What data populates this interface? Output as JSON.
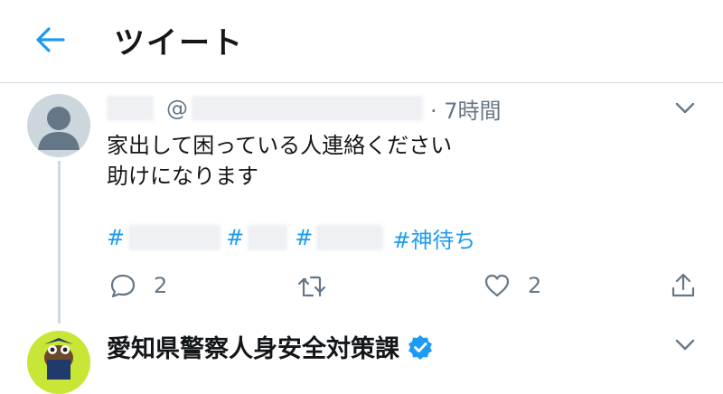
{
  "header": {
    "title": "ツイート",
    "back_icon": "arrow-left-icon"
  },
  "tweet": {
    "at_symbol": "@",
    "time": "· 7時間",
    "text": "家出して困っている人連絡ください\n助けになります",
    "hashtags": [
      "#",
      "#",
      "#",
      "#神待ち"
    ],
    "reply_count": "2",
    "like_count": "2"
  },
  "reply": {
    "author_name": "愛知県警察人身安全対策課"
  },
  "colors": {
    "accent": "#1d9bf0",
    "secondary_text": "#657786",
    "verified": "#1d9bf0",
    "border": "#cfd9de"
  }
}
